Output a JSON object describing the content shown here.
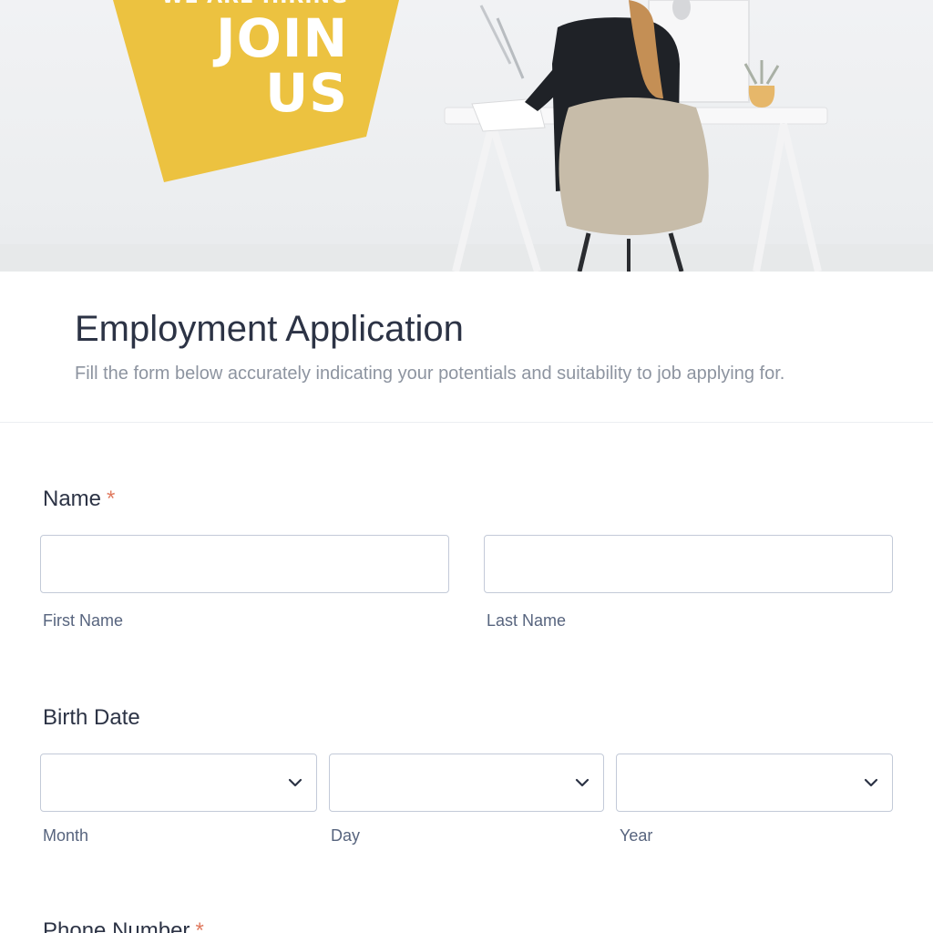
{
  "hero": {
    "banner_top_text": "WE ARE HIRING",
    "banner_line1": "JOIN",
    "banner_line2": "US",
    "banner_color": "#ecc240",
    "image_description_icon": "woman-at-desk-illustration"
  },
  "form": {
    "title": "Employment Application",
    "subtitle": "Fill the form below accurately indicating your potentials and suitability to job applying for.",
    "required_marker": "*",
    "accent_required_color": "#e07a5f",
    "name": {
      "label": "Name",
      "first_value": "",
      "last_value": "",
      "first_sublabel": "First Name",
      "last_sublabel": "Last Name"
    },
    "birth_date": {
      "label": "Birth Date",
      "month_value": "",
      "day_value": "",
      "year_value": "",
      "month_sublabel": "Month",
      "day_sublabel": "Day",
      "year_sublabel": "Year",
      "icon": "chevron-down-icon"
    },
    "phone": {
      "label": "Phone Number"
    }
  }
}
